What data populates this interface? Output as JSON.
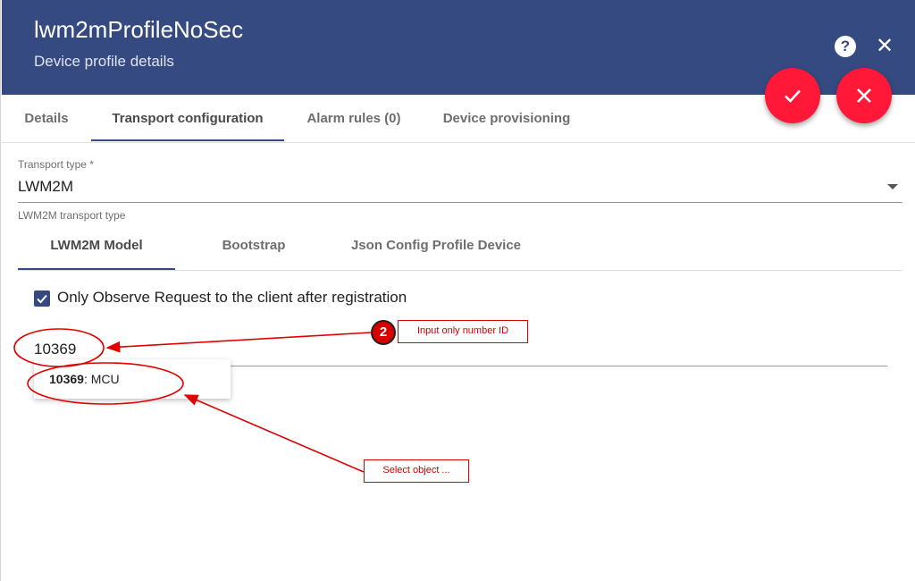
{
  "header": {
    "title": "lwm2mProfileNoSec",
    "subtitle": "Device profile details",
    "help_icon": "?",
    "close_icon": "✕"
  },
  "colors": {
    "header_bg": "#344a80",
    "accent_red": "#ff1838",
    "annotation_red": "#e00000"
  },
  "tabs": [
    {
      "label": "Details"
    },
    {
      "label": "Transport configuration",
      "active": true
    },
    {
      "label": "Alarm rules (0)"
    },
    {
      "label": "Device provisioning"
    }
  ],
  "transport": {
    "label": "Transport type *",
    "value": "LWM2M",
    "hint": "LWM2M transport type"
  },
  "subtabs": [
    {
      "label": "LWM2M Model",
      "active": true
    },
    {
      "label": "Bootstrap"
    },
    {
      "label": "Json Config Profile Device"
    }
  ],
  "observe": {
    "checked": true,
    "label": "Only Observe Request to the client after registration"
  },
  "object_input": {
    "value": "10369"
  },
  "autocomplete": {
    "option_id": "10369",
    "option_rest": ": MCU"
  },
  "annotations": {
    "step": "2",
    "callout_1": "Input only number ID",
    "callout_2": "Select object ..."
  }
}
